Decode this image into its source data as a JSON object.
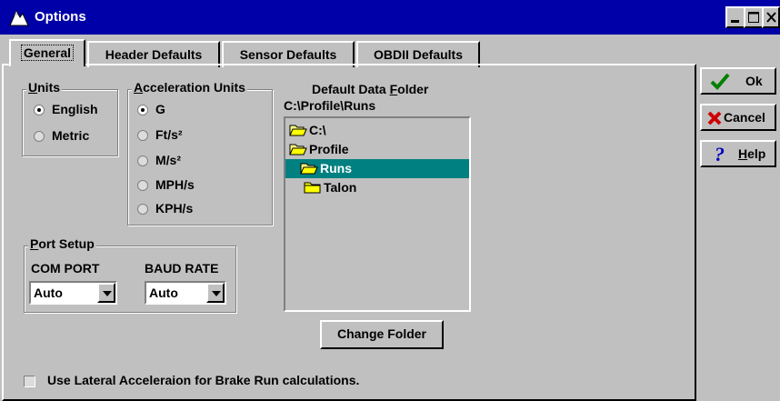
{
  "window": {
    "title": "Options",
    "icon": "app-icon"
  },
  "tabs": [
    {
      "label": "General",
      "active": true
    },
    {
      "label": "Header Defaults",
      "active": false
    },
    {
      "label": "Sensor Defaults",
      "active": false
    },
    {
      "label": "OBDII Defaults",
      "active": false
    }
  ],
  "units": {
    "legend": "Units",
    "options": [
      {
        "label": "English",
        "checked": true
      },
      {
        "label": "Metric",
        "checked": false
      }
    ]
  },
  "accel_units": {
    "legend": "Acceleration Units",
    "options": [
      {
        "label": "G",
        "checked": true
      },
      {
        "label": "Ft/s²",
        "checked": false
      },
      {
        "label": "M/s²",
        "checked": false
      },
      {
        "label": "MPH/s",
        "checked": false
      },
      {
        "label": "KPH/s",
        "checked": false
      }
    ]
  },
  "port_setup": {
    "legend": "Port Setup",
    "com_port_label": "COM PORT",
    "com_port_value": "Auto",
    "baud_rate_label": "BAUD RATE",
    "baud_rate_value": "Auto"
  },
  "data_folder": {
    "title": "Default Data Folder",
    "path": "C:\\Profile\\Runs",
    "tree": [
      {
        "label": "C:\\",
        "icon": "open-folder-icon"
      },
      {
        "label": "Profile",
        "icon": "open-folder-icon"
      },
      {
        "label": "Runs",
        "icon": "open-folder-icon",
        "selected": true
      },
      {
        "label": "Talon",
        "icon": "folder-icon"
      }
    ],
    "change_button": "Change Folder"
  },
  "lateral_checkbox": {
    "label": "Use Lateral Acceleraion for Brake Run calculations.",
    "checked": false
  },
  "buttons": {
    "ok": "Ok",
    "cancel": "Cancel",
    "help": "Help"
  },
  "colors": {
    "titlebar": "#0000a8",
    "face": "#c0c0c0",
    "selection": "#008080"
  }
}
